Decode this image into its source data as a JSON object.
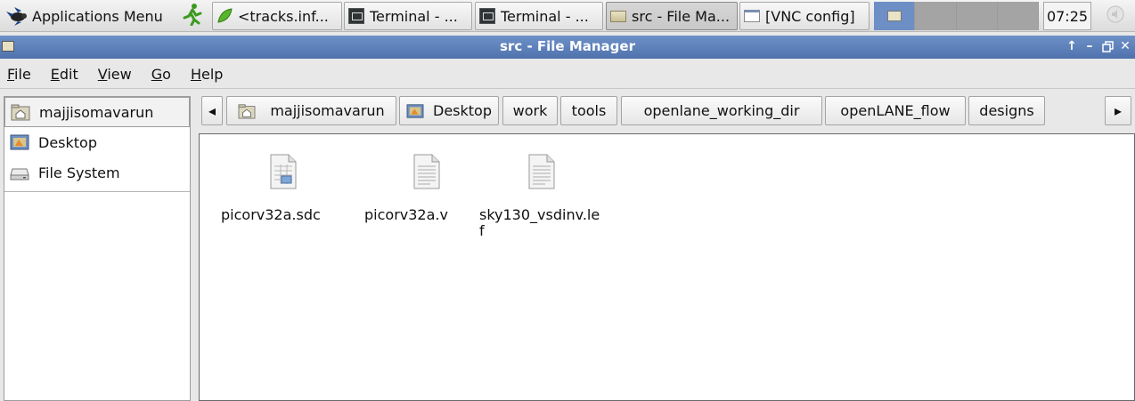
{
  "panel": {
    "applications_menu": "Applications Menu",
    "tasks": [
      {
        "label": "<tracks.inf...",
        "icon": "leaf-icon"
      },
      {
        "label": "Terminal - ...",
        "icon": "terminal-icon"
      },
      {
        "label": "Terminal - ...",
        "icon": "terminal-icon"
      },
      {
        "label": "src - File Ma...",
        "icon": "folder-icon",
        "active": true
      },
      {
        "label": "[VNC config]",
        "icon": "window-icon"
      }
    ],
    "clock": "07:25"
  },
  "window": {
    "title": "src - File Manager",
    "controls": {
      "up": "↑",
      "minimize": "–",
      "maximize": "🗗",
      "close": "✕"
    }
  },
  "menubar": {
    "file": "ile",
    "file_key": "F",
    "edit": "dit",
    "edit_key": "E",
    "view": "iew",
    "view_key": "V",
    "go": "o",
    "go_key": "G",
    "help": "elp",
    "help_key": "H"
  },
  "sidebar": {
    "items": [
      {
        "label": "majjisomavarun",
        "icon": "home-folder-icon"
      },
      {
        "label": "Desktop",
        "icon": "desktop-icon"
      },
      {
        "label": "File System",
        "icon": "drive-icon"
      }
    ]
  },
  "pathbar": {
    "crumbs": [
      "majjisomavarun",
      "Desktop",
      "work",
      "tools",
      "openlane_working_dir",
      "openLANE_flow",
      "designs"
    ],
    "scroll_left": "◂",
    "scroll_right": "▸"
  },
  "files": [
    {
      "name": "picorv32a.sdc",
      "icon": "spreadsheet-file-icon"
    },
    {
      "name": "picorv32a.v",
      "icon": "text-file-icon"
    },
    {
      "name": "sky130_vsdinv.lef",
      "icon": "text-file-icon"
    }
  ]
}
